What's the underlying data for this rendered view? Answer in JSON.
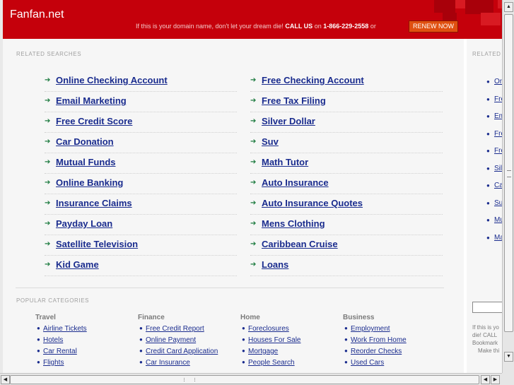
{
  "header": {
    "site_name": "Fanfan.net",
    "tagline_prefix": "If this is your domain name, don't let your dream die!",
    "call_us": "CALL US",
    "on_word": "on",
    "phone": "1-866-229-2558",
    "or_word": "or",
    "renew_label": "RENEW NOW"
  },
  "related_searches": {
    "title": "RELATED SEARCHES",
    "left": [
      "Online Checking Account",
      "Email Marketing",
      "Free Credit Score",
      "Car Donation",
      "Mutual Funds",
      "Online Banking",
      "Insurance Claims",
      "Payday Loan",
      "Satellite Television",
      "Kid Game"
    ],
    "right": [
      "Free Checking Account",
      "Free Tax Filing",
      "Silver Dollar",
      "Suv",
      "Math Tutor",
      "Auto Insurance",
      "Auto Insurance Quotes",
      "Mens Clothing",
      "Caribbean Cruise",
      "Loans"
    ]
  },
  "popular_categories": {
    "title": "POPULAR CATEGORIES",
    "columns": [
      {
        "heading": "Travel",
        "items": [
          "Airline Tickets",
          "Hotels",
          "Car Rental",
          "Flights"
        ]
      },
      {
        "heading": "Finance",
        "items": [
          "Free Credit Report",
          "Online Payment",
          "Credit Card Application",
          "Car Insurance"
        ]
      },
      {
        "heading": "Home",
        "items": [
          "Foreclosures",
          "Houses For Sale",
          "Mortgage",
          "People Search"
        ]
      },
      {
        "heading": "Business",
        "items": [
          "Employment",
          "Work From Home",
          "Reorder Checks",
          "Used Cars"
        ]
      }
    ]
  },
  "right_panel": {
    "title": "RELATED",
    "items": [
      "On",
      "Fre",
      "Em",
      "Fre",
      "Fre",
      "Silv",
      "Ca",
      "Su",
      "Mu",
      "Ma"
    ],
    "text_lines": [
      "If this is yo",
      "die! CALL",
      "Bookmark",
      "Make thi"
    ]
  },
  "scrollbars": {
    "up_arrow": "▲",
    "down_arrow": "▼",
    "left_arrow": "◀",
    "right_arrow": "▶"
  },
  "colors": {
    "header_bg": "#c5000b",
    "link": "#1a2c8e",
    "arrow": "#1b7a3e",
    "renew_button": "#e05010"
  }
}
